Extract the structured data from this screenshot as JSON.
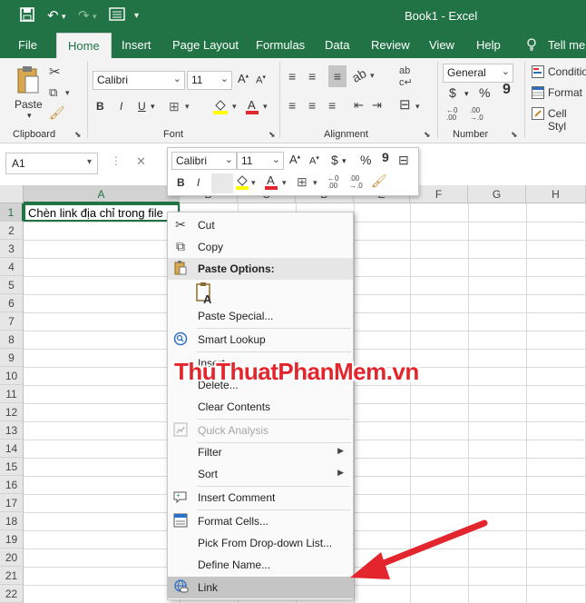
{
  "titlebar": {
    "title": "Book1  -  Excel"
  },
  "tabs": [
    "File",
    "Home",
    "Insert",
    "Page Layout",
    "Formulas",
    "Data",
    "Review",
    "View",
    "Help",
    "Tell me"
  ],
  "ribbon": {
    "clipboard": {
      "paste_label": "Paste",
      "group_label": "Clipboard"
    },
    "font": {
      "font_name": "Calibri",
      "font_size": "11",
      "group_label": "Font",
      "bold": "B",
      "italic": "I",
      "underline": "U"
    },
    "alignment": {
      "group_label": "Alignment"
    },
    "number": {
      "format": "General",
      "group_label": "Number",
      "currency": "$",
      "percent": "%",
      "comma": "9"
    },
    "styles": {
      "conditional": "Conditio",
      "format_as": "Format",
      "cell_styles": "Cell Styl"
    }
  },
  "formula_bar": {
    "name_box": "A1",
    "cancel_glyph": "✕"
  },
  "grid": {
    "columns": [
      "A",
      "B",
      "C",
      "D",
      "E",
      "F",
      "G",
      "H"
    ],
    "rows": [
      "1",
      "2",
      "3",
      "4",
      "5",
      "6",
      "7",
      "8",
      "9",
      "10",
      "11",
      "12",
      "13",
      "14",
      "15",
      "16",
      "17",
      "18",
      "19",
      "20",
      "21",
      "22"
    ],
    "cell_a1": "Chèn link địa chỉ trong file"
  },
  "mini_toolbar": {
    "font_name": "Calibri",
    "font_size": "11",
    "bold": "B",
    "italic": "I",
    "currency": "$",
    "percent": "%",
    "comma": "9"
  },
  "context_menu": {
    "items": [
      {
        "label": "Cut",
        "icon": "scissors-icon"
      },
      {
        "label": "Copy",
        "icon": "copy-icon"
      },
      {
        "label": "Paste Options:",
        "icon": "paste-icon"
      },
      {
        "label": "Paste Special...",
        "icon": ""
      },
      {
        "label": "Smart Lookup",
        "icon": "search-icon"
      },
      {
        "label": "Insert...",
        "icon": ""
      },
      {
        "label": "Delete...",
        "icon": ""
      },
      {
        "label": "Clear Contents",
        "icon": ""
      },
      {
        "label": "Quick Analysis",
        "icon": "quick-analysis-icon"
      },
      {
        "label": "Filter",
        "icon": ""
      },
      {
        "label": "Sort",
        "icon": ""
      },
      {
        "label": "Insert Comment",
        "icon": "comment-icon"
      },
      {
        "label": "Format Cells...",
        "icon": "format-cells-icon"
      },
      {
        "label": "Pick From Drop-down List...",
        "icon": ""
      },
      {
        "label": "Define Name...",
        "icon": ""
      },
      {
        "label": "Link",
        "icon": "link-icon"
      }
    ]
  },
  "watermark": "ThuThuatPhanMem.vn",
  "colors": {
    "excel_green": "#217346",
    "arrow_red": "#e3262d"
  }
}
